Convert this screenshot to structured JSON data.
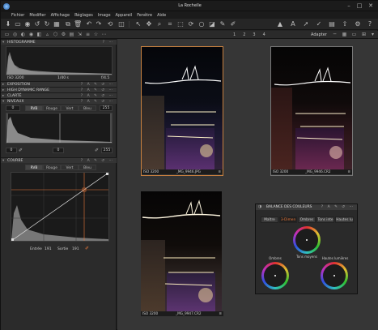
{
  "window": {
    "title": "La Rochelle",
    "min": "–",
    "max": "□",
    "close": "✕"
  },
  "menu": [
    "Fichier",
    "Modifier",
    "Affichage",
    "Réglages",
    "Image",
    "Appareil",
    "Fenêtre",
    "Aide"
  ],
  "tabs_bar": {
    "page_numbers": [
      "1",
      "2",
      "3",
      "4"
    ],
    "fit_label": "Adapter"
  },
  "left_panel": {
    "histogram": {
      "title": "HISTOGRAMME",
      "iso": "ISO 3200",
      "shutter": "1/40 s",
      "aperture": "f/4.5"
    },
    "sections": {
      "exposure": "EXPOSITION",
      "hdr": "HIGH DYNAMIC RANGE",
      "clarity": "CLARTÉ",
      "levels": "NIVEAUX"
    },
    "levels": {
      "input_black": "0",
      "input_white": "255",
      "channel_tabs": [
        "RVB",
        "Rouge",
        "Vert",
        "Bleu"
      ],
      "output_black": "0",
      "output_mid": "0",
      "output_white": "255"
    },
    "curve": {
      "title": "COURBE",
      "channel_tabs": [
        "RVB",
        "Rouge",
        "Vert",
        "Bleu"
      ],
      "input_label": "Entrée",
      "input_value": "191",
      "output_label": "Sortie",
      "output_value": "191"
    }
  },
  "photos": [
    {
      "iso": "ISO 3200",
      "name": "_MG_9946.JPG",
      "selected": true
    },
    {
      "iso": "ISO 3200",
      "name": "_MG_9946.CR2",
      "selected": false
    },
    {
      "iso": "ISO 3200",
      "name": "_MG_9947.CR2",
      "selected": false
    }
  ],
  "color_balance": {
    "title": "BALANCE DES COULEURS",
    "tabs": [
      "Maître",
      "3-Dimen",
      "Ombres",
      "Tons inte",
      "Hautes lu"
    ],
    "selected_tab": "3-Dimen",
    "labels": {
      "shadows": "Ombres",
      "midtones": "Tons moyens",
      "highlights": "Hautes lumières"
    }
  },
  "colors": {
    "accent": "#e8773a",
    "panel": "#2b2b2b",
    "viewer": "#363636"
  }
}
